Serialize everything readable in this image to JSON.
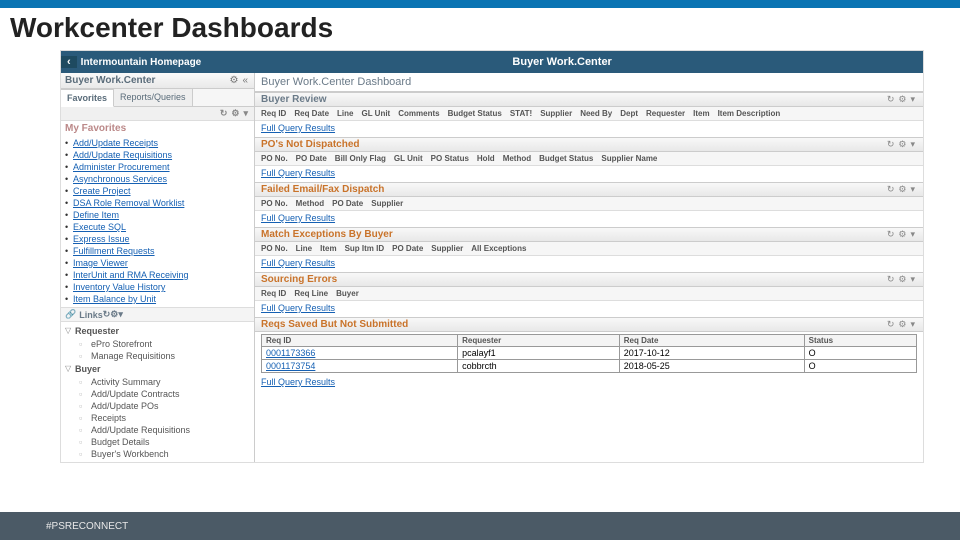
{
  "slide_title": "Workcenter Dashboards",
  "header": {
    "back_glyph": "‹",
    "home_label": "Intermountain Homepage",
    "center_title": "Buyer Work.Center"
  },
  "left": {
    "panel_title": "Buyer Work.Center",
    "gear": "⚙",
    "collapse": "«",
    "tabs": {
      "favorites": "Favorites",
      "reports": "Reports/Queries"
    },
    "fav_header_tools": {
      "refresh": "↻",
      "gear": "⚙",
      "arrow": "▾"
    },
    "fav_title": "My Favorites",
    "favorites": [
      "Add/Update Receipts",
      "Add/Update Requisitions",
      "Administer Procurement",
      "Asynchronous Services",
      "Create Project",
      "DSA Role Removal Worklist",
      "Define Item",
      "Execute SQL",
      "Express Issue",
      "Fulfillment Requests",
      "Image Viewer",
      "InterUnit and RMA Receiving",
      "Inventory Value History",
      "Item Balance by Unit"
    ],
    "links_hdr": "Links",
    "links_tools": {
      "refresh": "↻",
      "gear": "⚙",
      "arrow": "▾"
    },
    "tree": [
      {
        "label": "Requester",
        "items": [
          "ePro Storefront",
          "Manage Requisitions"
        ]
      },
      {
        "label": "Buyer",
        "items": [
          "Activity Summary",
          "Add/Update Contracts",
          "Add/Update POs",
          "Receipts",
          "Add/Update Requisitions",
          "Budget Details",
          "Buyer's Workbench"
        ]
      }
    ]
  },
  "right": {
    "dash_title": "Buyer Work.Center Dashboard",
    "blocks": [
      {
        "title": "Buyer Review",
        "cols": [
          "Req ID",
          "Req Date",
          "Line",
          "GL Unit",
          "Comments",
          "Budget Status",
          "STAT!",
          "Supplier",
          "Need By",
          "Dept",
          "Requester",
          "Item",
          "Item Description"
        ],
        "full": "Full Query Results",
        "orange": false
      },
      {
        "title": "PO's Not Dispatched",
        "cols": [
          "PO No.",
          "PO Date",
          "Bill Only Flag",
          "GL Unit",
          "PO Status",
          "Hold",
          "Method",
          "Budget Status",
          "Supplier Name"
        ],
        "full": "Full Query Results",
        "orange": true
      },
      {
        "title": "Failed Email/Fax Dispatch",
        "cols": [
          "PO No.",
          "Method",
          "PO Date",
          "Supplier"
        ],
        "full": "Full Query Results",
        "orange": true
      },
      {
        "title": "Match Exceptions By Buyer",
        "cols": [
          "PO No.",
          "Line",
          "Item",
          "Sup Itm ID",
          "PO Date",
          "Supplier",
          "All Exceptions"
        ],
        "full": "Full Query Results",
        "orange": true
      },
      {
        "title": "Sourcing Errors",
        "cols": [
          "Req ID",
          "Req Line",
          "Buyer"
        ],
        "full": "Full Query Results",
        "orange": true
      }
    ],
    "saved_block": {
      "title": "Reqs Saved But Not Submitted",
      "cols": [
        "Req ID",
        "Requester",
        "Req Date",
        "Status"
      ],
      "rows": [
        [
          "0001173366",
          "pcalayf1",
          "2017-10-12",
          "O"
        ],
        [
          "0001173754",
          "cobbrcth",
          "2018-05-25",
          "O"
        ]
      ],
      "full": "Full Query Results"
    },
    "tools": {
      "refresh": "↻",
      "gear": "⚙",
      "arrow": "▾"
    }
  },
  "footer": "#PSRECONNECT"
}
